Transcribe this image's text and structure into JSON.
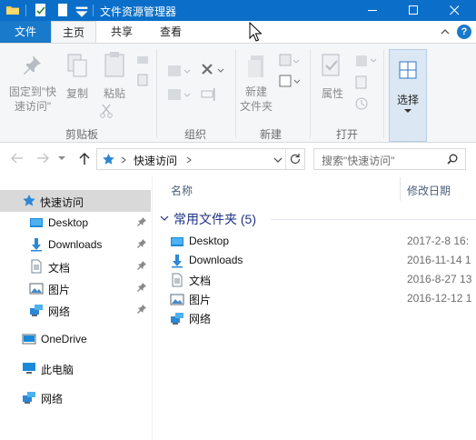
{
  "window": {
    "title": "文件资源管理器"
  },
  "ribbon": {
    "tabs": [
      "文件",
      "主页",
      "共享",
      "查看"
    ],
    "help_label": "?",
    "clipboard": {
      "pin_line1": "固定到\"快",
      "pin_line2": "速访问\"",
      "copy": "复制",
      "paste": "粘贴",
      "group": "剪贴板"
    },
    "organize": {
      "group": "组织"
    },
    "new": {
      "folder_line1": "新建",
      "folder_line2": "文件夹",
      "group": "新建"
    },
    "open": {
      "properties": "属性",
      "group": "打开"
    },
    "select": {
      "label": "选择"
    }
  },
  "address": {
    "path": [
      "快速访问"
    ],
    "search_placeholder": "搜索\"快速访问\""
  },
  "nav_pane": {
    "items": [
      {
        "label": "快速访问",
        "icon": "star-icon",
        "selected": true
      },
      {
        "label": "Desktop",
        "icon": "desktop-folder-icon",
        "pinned": true
      },
      {
        "label": "Downloads",
        "icon": "downloads-folder-icon",
        "pinned": true
      },
      {
        "label": "文档",
        "icon": "documents-folder-icon",
        "pinned": true
      },
      {
        "label": "图片",
        "icon": "pictures-folder-icon",
        "pinned": true
      },
      {
        "label": "网络",
        "icon": "network-icon",
        "pinned": true
      },
      {
        "label": "OneDrive",
        "icon": "onedrive-icon"
      },
      {
        "label": "此电脑",
        "icon": "this-pc-icon"
      },
      {
        "label": "网络",
        "icon": "network-icon"
      }
    ]
  },
  "content": {
    "columns": {
      "name": "名称",
      "modified": "修改日期"
    },
    "group_header": "常用文件夹 (5)",
    "rows": [
      {
        "name": "Desktop",
        "date": "2017-2-8 16:",
        "icon": "desktop-folder-icon"
      },
      {
        "name": "Downloads",
        "date": "2016-11-14 1",
        "icon": "downloads-folder-icon"
      },
      {
        "name": "文档",
        "date": "2016-8-27 13",
        "icon": "documents-folder-icon"
      },
      {
        "name": "图片",
        "date": "2016-12-12 1",
        "icon": "pictures-folder-icon"
      },
      {
        "name": "网络",
        "date": "",
        "icon": "network-icon"
      }
    ]
  },
  "colors": {
    "titlebar": "#0b6fc9",
    "file_tab": "#1979ca",
    "group_header": "#1e3287",
    "selection": "#d9d9d9"
  }
}
